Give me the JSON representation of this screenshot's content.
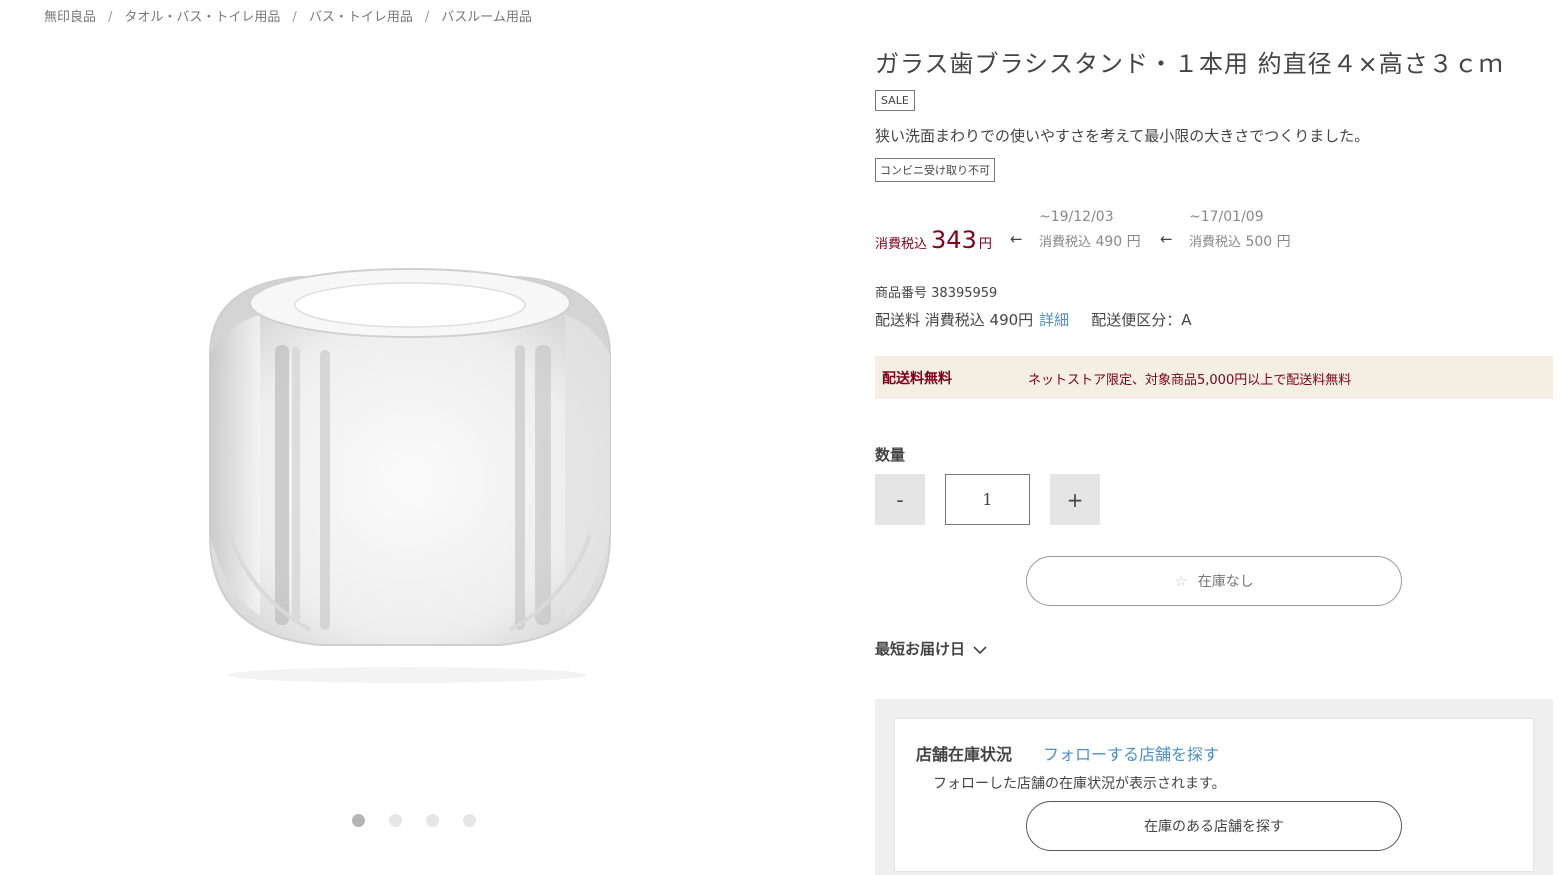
{
  "breadcrumb": [
    "無印良品",
    "タオル・バス・トイレ用品",
    "バス・トイレ用品",
    "バスルーム用品"
  ],
  "breadcrumb_sep": "/",
  "product": {
    "title": "ガラス歯ブラシスタンド・１本用 約直径４×高さ３ｃｍ",
    "sale_badge": "SALE",
    "description": "狭い洗面まわりでの使いやすさを考えて最小限の大きさでつくりました。",
    "cvs_badge": "コンビニ受け取り不可"
  },
  "price": {
    "tax_label": "消費税込",
    "current": "343",
    "yen": "円",
    "arrow": "←",
    "history": [
      {
        "date": "~19/12/03",
        "label": "消費税込",
        "value": "490",
        "yen": "円"
      },
      {
        "date": "~17/01/09",
        "label": "消費税込",
        "value": "500",
        "yen": "円"
      }
    ]
  },
  "item_number": {
    "label": "商品番号",
    "value": "38395959"
  },
  "shipping": {
    "label": "配送料 消費税込 490円",
    "detail_link": "詳細",
    "class_label": "配送便区分：A"
  },
  "free_shipping": {
    "head": "配送料無料",
    "text": "ネットストア限定、対象商品5,000円以上で配送料無料"
  },
  "quantity": {
    "label": "数量",
    "minus": "-",
    "value": "1",
    "plus": "+"
  },
  "stock_button": {
    "star": "☆",
    "label": "在庫なし"
  },
  "delivery": {
    "label": "最短お届け日"
  },
  "store": {
    "title": "店舗在庫状況",
    "link": "フォローする店舗を探す",
    "note": "フォローした店舗の在庫状況が表示されます。",
    "button": "在庫のある店舗を探す"
  },
  "gallery": {
    "dot_count": 4,
    "active_index": 0
  },
  "colors": {
    "accent_red": "#7f0019",
    "link_blue": "#4a90c8",
    "free_ship_bg": "#f4efe2"
  }
}
